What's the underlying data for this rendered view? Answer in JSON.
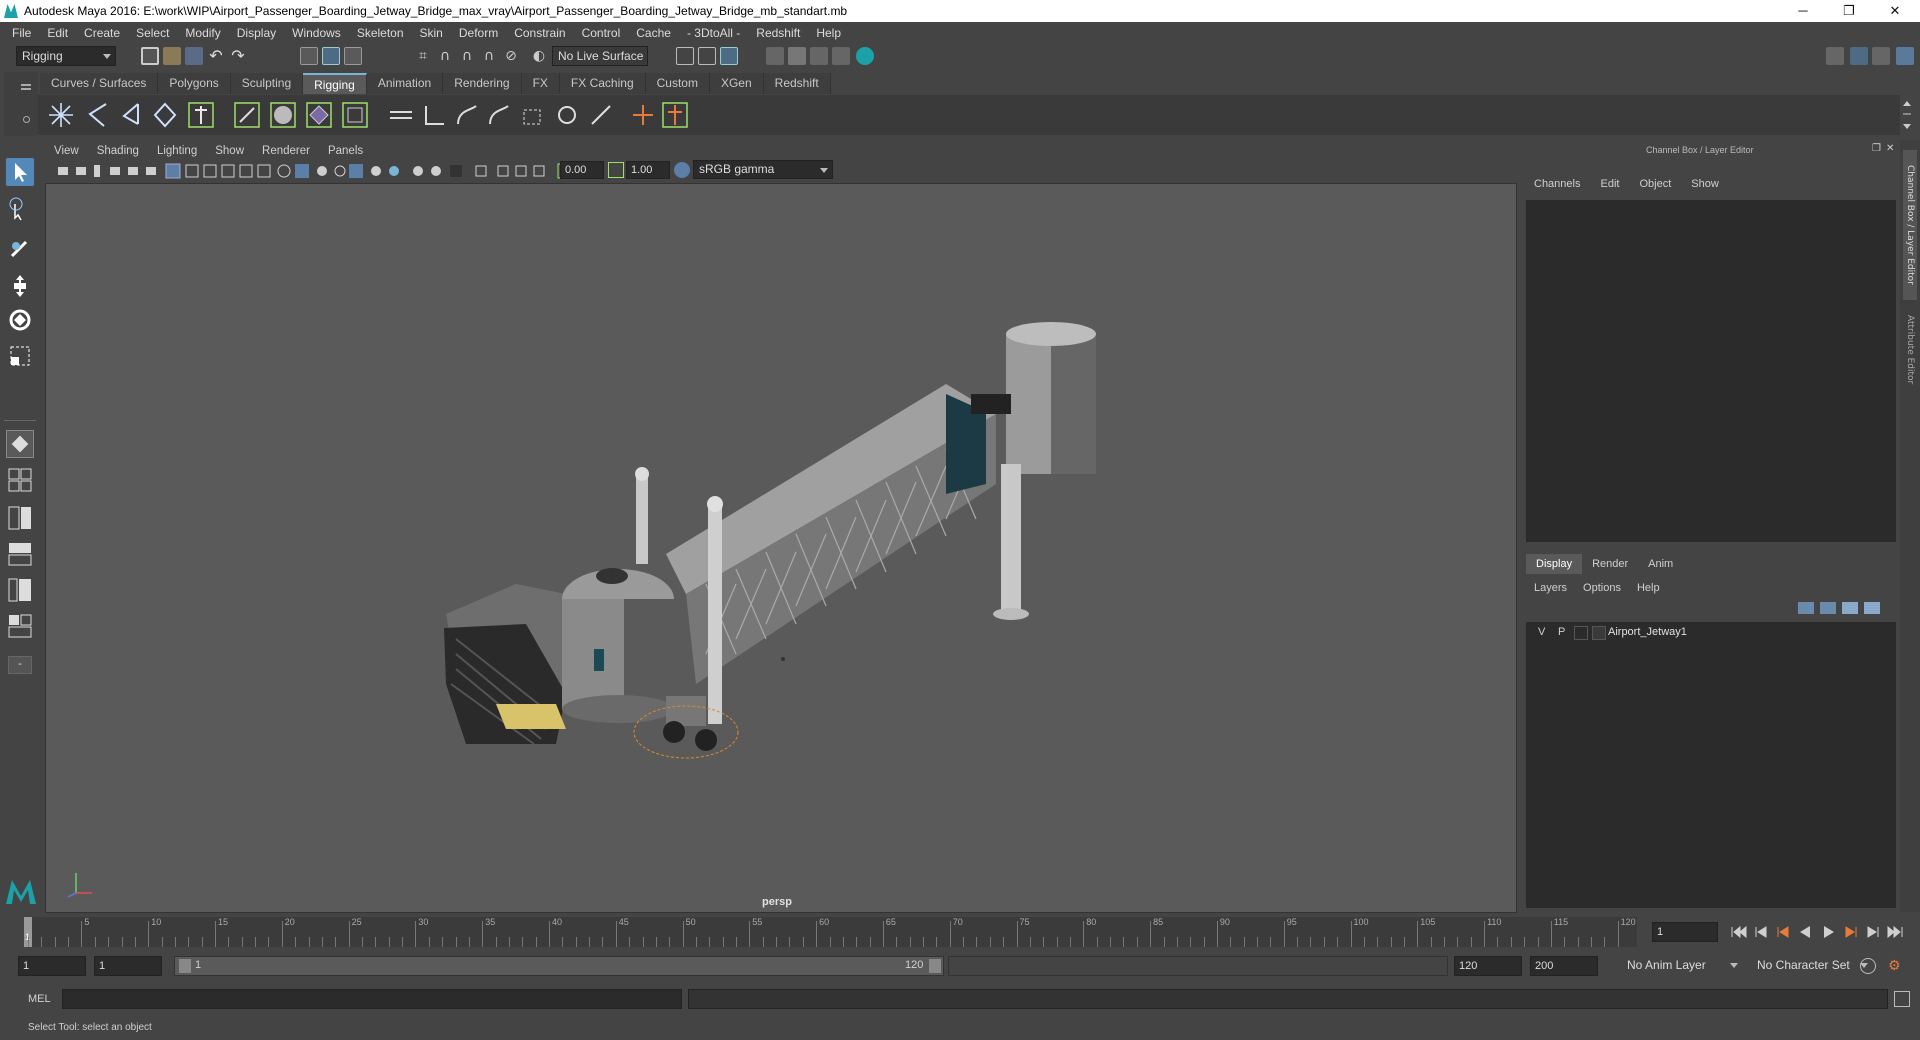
{
  "window": {
    "title": "Autodesk Maya 2016: E:\\work\\WIP\\Airport_Passenger_Boarding_Jetway_Bridge_max_vray\\Airport_Passenger_Boarding_Jetway_Bridge_mb_standart.mb",
    "minimize": "─",
    "restore": "❐",
    "close": "✕"
  },
  "menu": [
    "File",
    "Edit",
    "Create",
    "Select",
    "Modify",
    "Display",
    "Windows",
    "Skeleton",
    "Skin",
    "Deform",
    "Constrain",
    "Control",
    "Cache",
    "- 3DtoAll -",
    "Redshift",
    "Help"
  ],
  "statusline": {
    "mode": "Rigging",
    "live_surface": "No Live Surface"
  },
  "shelf": {
    "tabs": [
      "Curves / Surfaces",
      "Polygons",
      "Sculpting",
      "Rigging",
      "Animation",
      "Rendering",
      "FX",
      "FX Caching",
      "Custom",
      "XGen",
      "Redshift"
    ],
    "active_tab": "Rigging"
  },
  "viewport": {
    "menu": [
      "View",
      "Shading",
      "Lighting",
      "Show",
      "Renderer",
      "Panels"
    ],
    "exposure": "0.00",
    "gamma": "1.00",
    "color_space": "sRGB gamma",
    "camera_label": "persp",
    "axis": {
      "x": "x",
      "y": "y",
      "z": "z"
    }
  },
  "channel_box": {
    "title": "Channel Box / Layer Editor",
    "menu": [
      "Channels",
      "Edit",
      "Object",
      "Show"
    ]
  },
  "layer_editor": {
    "tabs": [
      "Display",
      "Render",
      "Anim"
    ],
    "active_tab": "Display",
    "menu": [
      "Layers",
      "Options",
      "Help"
    ],
    "layers": [
      {
        "v": "V",
        "p": "P",
        "name": "Airport_Jetway1"
      }
    ]
  },
  "side_tabs": [
    "Channel Box / Layer Editor",
    "Attribute Editor"
  ],
  "timeline": {
    "ticks": [
      "5",
      "10",
      "15",
      "20",
      "25",
      "30",
      "35",
      "40",
      "45",
      "50",
      "55",
      "60",
      "65",
      "70",
      "75",
      "80",
      "85",
      "90",
      "95",
      "100",
      "105",
      "110",
      "115",
      "120"
    ],
    "start_marker": "1",
    "current_frame": "1"
  },
  "range": {
    "start": "1",
    "playback_start": "1",
    "slider_start": "1",
    "slider_end": "120",
    "playback_end": "120",
    "end": "200",
    "anim_layer": "No Anim Layer",
    "character_set": "No Character Set"
  },
  "command_line": {
    "label": "MEL"
  },
  "help_line": {
    "text": "Select Tool: select an object"
  },
  "colors": {
    "accent": "#7ab4d8",
    "maya_teal": "#1aa2a8",
    "selection_orange": "#d98a2b"
  }
}
